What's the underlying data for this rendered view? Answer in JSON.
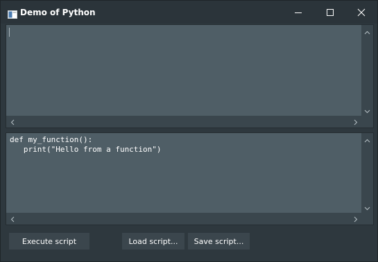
{
  "window": {
    "title": "Demo of Python",
    "controls": [
      "minimize",
      "maximize",
      "close"
    ]
  },
  "output_editor": {
    "text": ""
  },
  "script_editor": {
    "text": "def my_function():\n   print(\"Hello from a function\")"
  },
  "buttons": {
    "execute": "Execute script",
    "load": "Load script...",
    "save": "Save script..."
  },
  "icons": {
    "app": "app-window-icon",
    "minimize": "minimize-icon",
    "maximize": "maximize-icon",
    "close": "close-icon",
    "scroll_up": "chevron-up-icon",
    "scroll_down": "chevron-down-icon",
    "scroll_left": "chevron-left-icon",
    "scroll_right": "chevron-right-icon"
  },
  "colors": {
    "window_bg": "#2e383e",
    "titlebar_bg": "#2b343a",
    "editor_bg": "#4f5e66",
    "scrollbar_bg": "#3a464d",
    "button_bg": "#3b464d",
    "text": "#ffffff"
  }
}
